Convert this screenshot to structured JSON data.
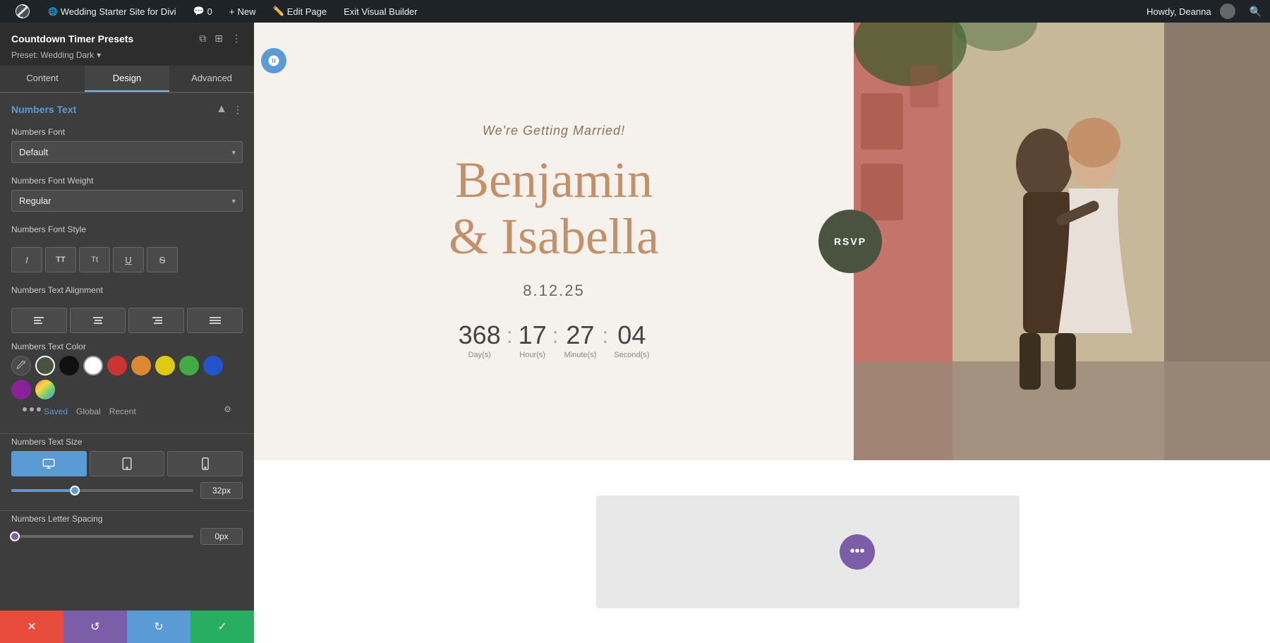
{
  "adminBar": {
    "wpIcon": "wordpress-icon",
    "siteName": "Wedding Starter Site for Divi",
    "comments": "0",
    "newLabel": "New",
    "editPageLabel": "Edit Page",
    "exitBuilderLabel": "Exit Visual Builder",
    "howdyLabel": "Howdy, Deanna"
  },
  "panel": {
    "title": "Countdown Timer Presets",
    "preset": "Preset: Wedding Dark",
    "tabs": [
      "Content",
      "Design",
      "Advanced"
    ],
    "activeTab": "Design",
    "section": {
      "title": "Numbers Text",
      "fields": {
        "fontLabel": "Numbers Font",
        "fontValue": "Default",
        "fontWeightLabel": "Numbers Font Weight",
        "fontWeightValue": "Regular",
        "fontStyleLabel": "Numbers Font Style",
        "fontStyleButtons": [
          "I",
          "TT",
          "Tt",
          "U",
          "S"
        ],
        "alignmentLabel": "Numbers Text Alignment",
        "colorLabel": "Numbers Text Color",
        "colorTabs": [
          "Saved",
          "Global",
          "Recent"
        ],
        "activeColorTab": "Saved",
        "textSizeLabel": "Numbers Text Size",
        "textSizeValue": "32px",
        "textSizeSliderPercent": 35,
        "letterSpacingLabel": "Numbers Letter Spacing",
        "letterSpacingValue": "0px",
        "letterSpacingSliderPercent": 2
      }
    }
  },
  "bottomBar": {
    "cancel": "✕",
    "undo": "↺",
    "redo": "↻",
    "save": "✓"
  },
  "weddingContent": {
    "subtitle": "We're Getting Married!",
    "names": "Benjamin\n& Isabella",
    "date": "8.12.25",
    "countdown": {
      "days": "368",
      "hours": "17",
      "minutes": "27",
      "seconds": "04",
      "daysLabel": "Day(s)",
      "hoursLabel": "Hour(s)",
      "minutesLabel": "Minute(s)",
      "secondsLabel": "Second(s)"
    },
    "rsvp": "RSVP"
  },
  "colors": {
    "eyedropper": "🔍",
    "swatches": [
      {
        "color": "#4a5240",
        "active": true
      },
      {
        "color": "#111111",
        "active": false
      },
      {
        "color": "#ffffff",
        "active": false
      },
      {
        "color": "#cc3333",
        "active": false
      },
      {
        "color": "#dd8833",
        "active": false
      },
      {
        "color": "#ddcc11",
        "active": false
      },
      {
        "color": "#44aa44",
        "active": false
      },
      {
        "color": "#2255cc",
        "active": false
      },
      {
        "color": "#882299",
        "active": false
      },
      {
        "color": "gradient",
        "active": false
      }
    ]
  }
}
